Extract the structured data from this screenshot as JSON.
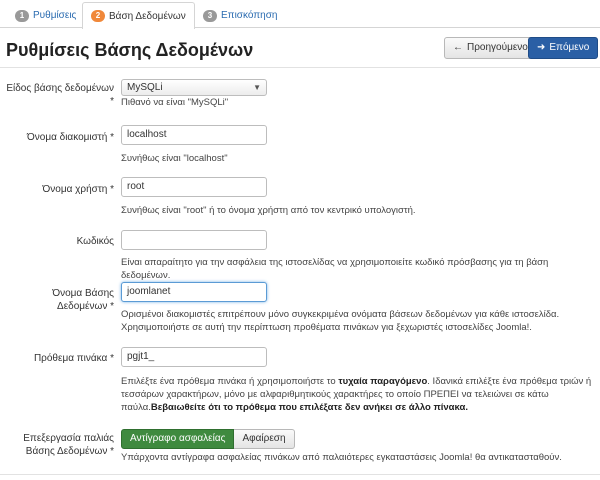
{
  "tabs": [
    {
      "num": "1",
      "label": "Ρυθμίσεις",
      "active": false
    },
    {
      "num": "2",
      "label": "Βάση Δεδομένων",
      "active": true
    },
    {
      "num": "3",
      "label": "Επισκόπηση",
      "active": false
    }
  ],
  "header": {
    "title": "Ρυθμίσεις Βάσης Δεδομένων",
    "prev_label": "Προηγούμενο",
    "next_label": "Επόμενο"
  },
  "form": {
    "db_type": {
      "label": "Είδος βάσης δεδομένων *",
      "value": "MySQLi",
      "help": "Πιθανό να είναι \"MySQLi\""
    },
    "host": {
      "label": "Όνομα διακομιστή *",
      "value": "localhost",
      "help": "Συνήθως είναι \"localhost\""
    },
    "user": {
      "label": "Όνομα χρήστη *",
      "value": "root",
      "help": "Συνήθως είναι \"root\" ή το όνομα χρήστη από τον κεντρικό υπολογιστή."
    },
    "password": {
      "label": "Κωδικός",
      "value": "",
      "help": "Είναι απαραίτητο για την ασφάλεια της ιστοσελίδας να χρησιμοποιείτε κωδικό πρόσβασης για τη βάση δεδομένων."
    },
    "db_name": {
      "label": "Όνομα Βάσης Δεδομένων *",
      "value": "joomlanet",
      "help_line1": "Ορισμένοι διακομιστές επιτρέπουν μόνο συγκεκριμένα ονόματα βάσεων δεδομένων για κάθε ιστοσελίδα.",
      "help_line2": "Χρησιμοποιήστε σε αυτή την περίπτωση προθέματα πινάκων για ξεχωριστές ιστοσελίδες Joomla!."
    },
    "prefix": {
      "label": "Πρόθεμα πινάκα *",
      "value": "pgjt1_",
      "help_a": "Επιλέξτε ένα πρόθεμα πινάκα ή χρησιμοποιήστε το ",
      "help_b": "τυχαία παραγόμενο",
      "help_c": ". Ιδανικά επιλέξτε ένα πρόθεμα τριών ή",
      "help_line2": "τεσσάρων χαρακτήρων, μόνο με αλφαριθμητικούς χαρακτήρες το οποίο ΠΡΕΠΕΙ να τελειώνει σε κάτω",
      "help_line3a": "παύλα.",
      "help_line3b": "Βεβαιωθείτε ότι το πρόθεμα που επιλέξατε δεν ανήκει σε άλλο πίνακα."
    },
    "old_db": {
      "label": "Επεξεργασία παλιάς Βάσης Δεδομένων *",
      "backup_label": "Αντίγραφο ασφαλείας",
      "remove_label": "Αφαίρεση",
      "help": "Υπάρχοντα αντίγραφα ασφαλείας πινάκων από παλαιότερες εγκαταστάσεις Joomla! θα αντικατασταθούν."
    }
  }
}
